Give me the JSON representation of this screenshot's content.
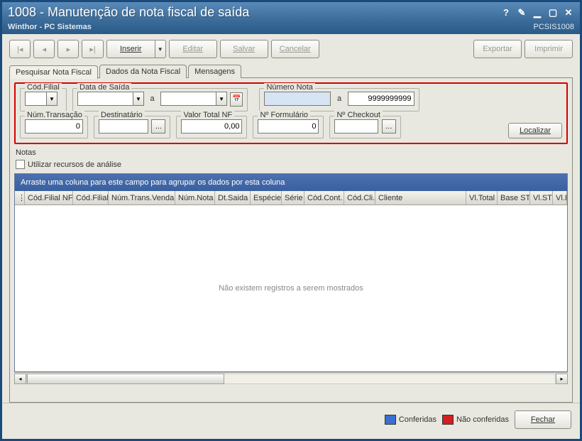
{
  "window": {
    "title": "1008 - Manutenção de nota fiscal de saída",
    "subtitle": "Winthor - PC Sistemas",
    "code": "PCSIS1008"
  },
  "toolbar": {
    "first": "⏮",
    "prev": "◀",
    "next": "▶",
    "last": "⏭",
    "inserir": "Inserir",
    "editar": "Editar",
    "salvar": "Salvar",
    "cancelar": "Cancelar",
    "exportar": "Exportar",
    "imprimir": "Imprimir"
  },
  "tabs": {
    "pesquisar": "Pesquisar Nota Fiscal",
    "dados": "Dados da Nota Fiscal",
    "mensagens": "Mensagens"
  },
  "filters": {
    "cod_filial": {
      "label": "Cód.Filial",
      "value": ""
    },
    "data_saida": {
      "label": "Data de Saída",
      "from": "",
      "sep": "a",
      "to": ""
    },
    "numero_nota": {
      "label": "Número Nota",
      "from": "",
      "sep": "a",
      "to": "9999999999"
    },
    "num_transacao": {
      "label": "Núm.Transação",
      "value": "0"
    },
    "destinatario": {
      "label": "Destinatário",
      "value": ""
    },
    "valor_total": {
      "label": "Valor Total NF",
      "value": "0,00"
    },
    "n_formulario": {
      "label": "Nº Formulário",
      "value": "0"
    },
    "n_checkout": {
      "label": "Nº Checkout",
      "value": ""
    },
    "localizar": "Localizar"
  },
  "notas": {
    "header": "Notas",
    "checkbox": "Utilizar recursos de análise",
    "grouphint": "Arraste uma coluna para este campo para agrupar os dados por esta coluna",
    "empty": "Não existem registros a serem mostrados",
    "cols": [
      "Cód.Filial NF",
      "Cód.Filial",
      "Núm.Trans.Venda",
      "Núm.Nota",
      "Dt.Saida",
      "Espécie",
      "Série",
      "Cód.Cont.",
      "Cód.Cli.",
      "Cliente",
      "Vl.Total",
      "Base ST",
      "Vl.ST",
      "Vl.De"
    ]
  },
  "legend": {
    "conferidas": {
      "label": "Conferidas",
      "color": "#3a70d0"
    },
    "nao_conferidas": {
      "label": "Não conferidas",
      "color": "#d02020"
    }
  },
  "footer": {
    "fechar": "Fechar"
  }
}
